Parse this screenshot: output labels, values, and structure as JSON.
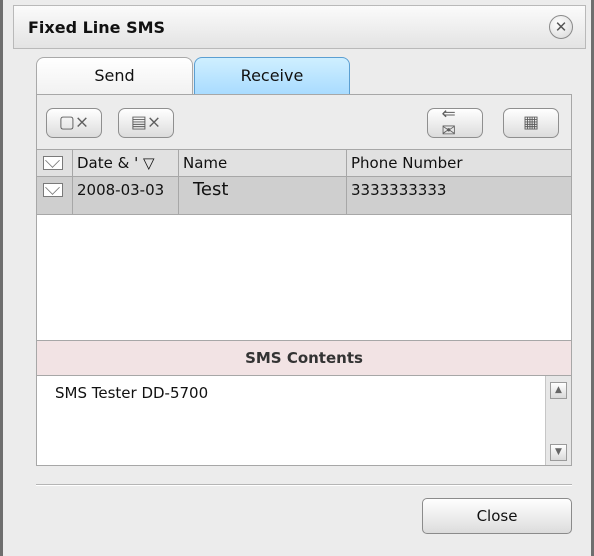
{
  "window": {
    "title": "Fixed Line SMS"
  },
  "tabs": [
    {
      "label": "Send",
      "selected": false
    },
    {
      "label": "Receive",
      "selected": true
    }
  ],
  "toolbar": {
    "left_buttons": [
      "delete-message-icon",
      "delete-all-messages-icon"
    ],
    "right_buttons": [
      "reply-message-icon",
      "view-message-icon"
    ]
  },
  "message_table": {
    "columns": [
      "",
      "Date & ' ▽",
      "Name",
      "Phone Number"
    ],
    "rows": [
      {
        "date": "2008-03-03",
        "name": "Test",
        "phone": "3333333333"
      }
    ]
  },
  "sms_contents": {
    "header": "SMS Contents",
    "text": "SMS Tester DD-5700"
  },
  "footer": {
    "close_label": "Close"
  },
  "colors": {
    "receive_tab": "#a8dbff",
    "selected_row": "#cfcfcf",
    "sms_header_bg": "#f2e3e4"
  }
}
